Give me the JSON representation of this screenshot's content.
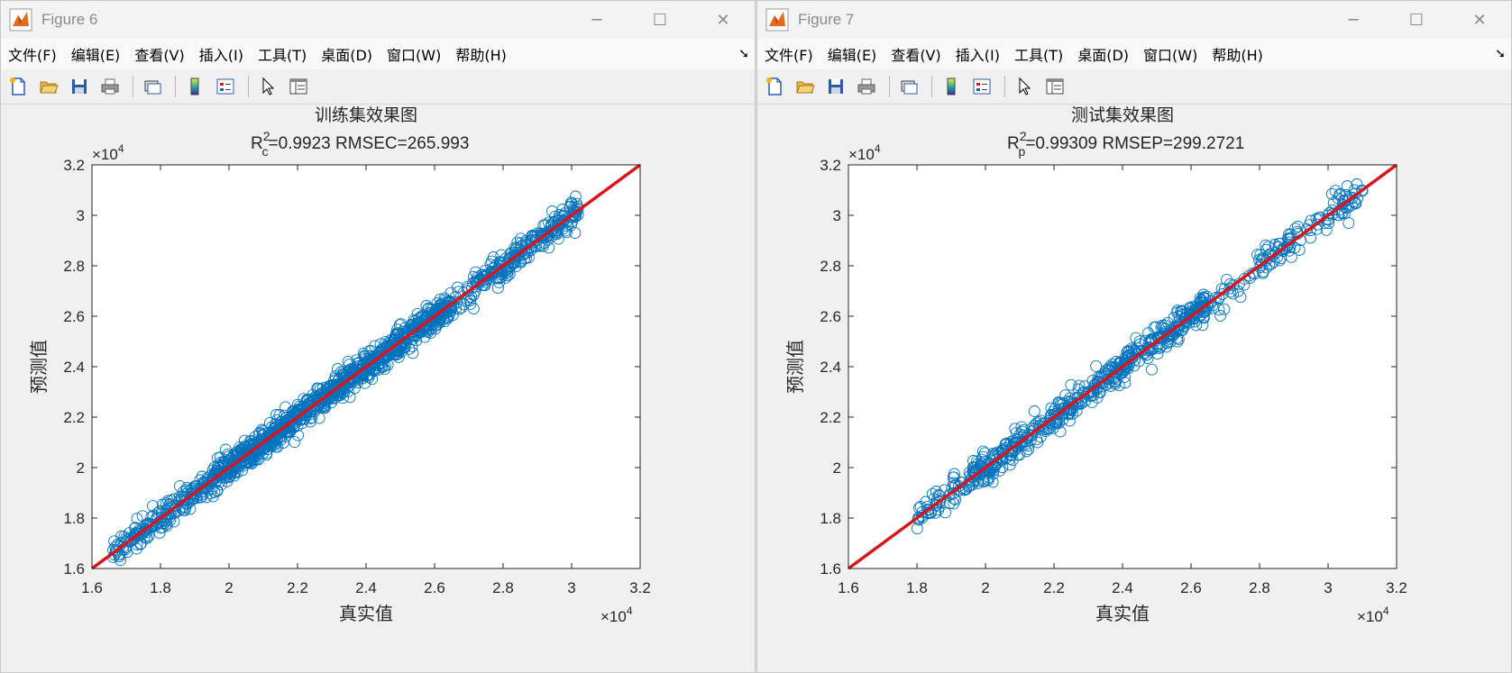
{
  "windows": [
    {
      "title": "Figure 6",
      "menu": [
        "文件(F)",
        "编辑(E)",
        "查看(V)",
        "插入(I)",
        "工具(T)",
        "桌面(D)",
        "窗口(W)",
        "帮助(H)"
      ],
      "plot": {
        "title": "训练集效果图",
        "subtitle_prefix": "R",
        "subtitle_sup": "2",
        "subtitle_sub": "c",
        "subtitle_rest": "=0.9923  RMSEC=265.993",
        "xlabel": "真实值",
        "ylabel": "预测值",
        "exponent_base": "×10",
        "exponent_power": "4",
        "x_ticks": [
          "1.6",
          "1.8",
          "2",
          "2.2",
          "2.4",
          "2.6",
          "2.8",
          "3",
          "3.2"
        ],
        "y_ticks": [
          "1.6",
          "1.8",
          "2",
          "2.2",
          "2.4",
          "2.6",
          "2.8",
          "3",
          "3.2"
        ]
      }
    },
    {
      "title": "Figure 7",
      "menu": [
        "文件(F)",
        "编辑(E)",
        "查看(V)",
        "插入(I)",
        "工具(T)",
        "桌面(D)",
        "窗口(W)",
        "帮助(H)"
      ],
      "plot": {
        "title": "测试集效果图",
        "subtitle_prefix": "R",
        "subtitle_sup": "2",
        "subtitle_sub": "p",
        "subtitle_rest": "=0.99309  RMSEP=299.2721",
        "xlabel": "真实值",
        "ylabel": "预测值",
        "exponent_base": "×10",
        "exponent_power": "4",
        "x_ticks": [
          "1.6",
          "1.8",
          "2",
          "2.2",
          "2.4",
          "2.6",
          "2.8",
          "3",
          "3.2"
        ],
        "y_ticks": [
          "1.6",
          "1.8",
          "2",
          "2.2",
          "2.4",
          "2.6",
          "2.8",
          "3",
          "3.2"
        ]
      }
    }
  ],
  "colors": {
    "marker": "#0072bd",
    "fit_line": "#d9141a",
    "axes": "#262626",
    "background": "#ffffff"
  },
  "chart_data": [
    {
      "type": "scatter",
      "title": "训练集效果图",
      "xlabel": "真实值",
      "ylabel": "预测值",
      "xlim": [
        16000,
        32000
      ],
      "ylim": [
        16000,
        32000
      ],
      "grid": false,
      "series": [
        {
          "name": "",
          "marker": "circle-open",
          "x_range": [
            16600,
            30200
          ],
          "description_points": [
            [
              17000,
              17100
            ],
            [
              18000,
              18050
            ],
            [
              19000,
              18950
            ],
            [
              20000,
              20050
            ],
            [
              21000,
              21000
            ],
            [
              22000,
              22050
            ],
            [
              23000,
              22950
            ],
            [
              24000,
              24050
            ],
            [
              25000,
              25000
            ],
            [
              26000,
              26050
            ],
            [
              27000,
              27000
            ],
            [
              28000,
              28050
            ],
            [
              29000,
              28900
            ],
            [
              30100,
              30100
            ],
            [
              30100,
              29300
            ],
            [
              29400,
              29400
            ]
          ]
        },
        {
          "name": "",
          "type": "line",
          "x": [
            16000,
            32000
          ],
          "y": [
            16000,
            32000
          ]
        }
      ]
    },
    {
      "type": "scatter",
      "title": "测试集效果图",
      "xlabel": "真实值",
      "ylabel": "预测值",
      "xlim": [
        16000,
        32000
      ],
      "ylim": [
        16000,
        32000
      ],
      "grid": false,
      "series": [
        {
          "name": "",
          "marker": "circle-open",
          "x_range": [
            18000,
            31000
          ],
          "description_points": [
            [
              18100,
              18150
            ],
            [
              19000,
              19000
            ],
            [
              20000,
              20050
            ],
            [
              21000,
              21000
            ],
            [
              22000,
              22050
            ],
            [
              23000,
              23000
            ],
            [
              24000,
              24050
            ],
            [
              25000,
              25000
            ],
            [
              26000,
              26050
            ],
            [
              27000,
              27000
            ],
            [
              28000,
              28050
            ],
            [
              29000,
              29000
            ],
            [
              30000,
              30000
            ],
            [
              30800,
              30500
            ],
            [
              30600,
              29700
            ]
          ]
        },
        {
          "name": "",
          "type": "line",
          "x": [
            16000,
            32000
          ],
          "y": [
            16000,
            32000
          ]
        }
      ]
    }
  ]
}
